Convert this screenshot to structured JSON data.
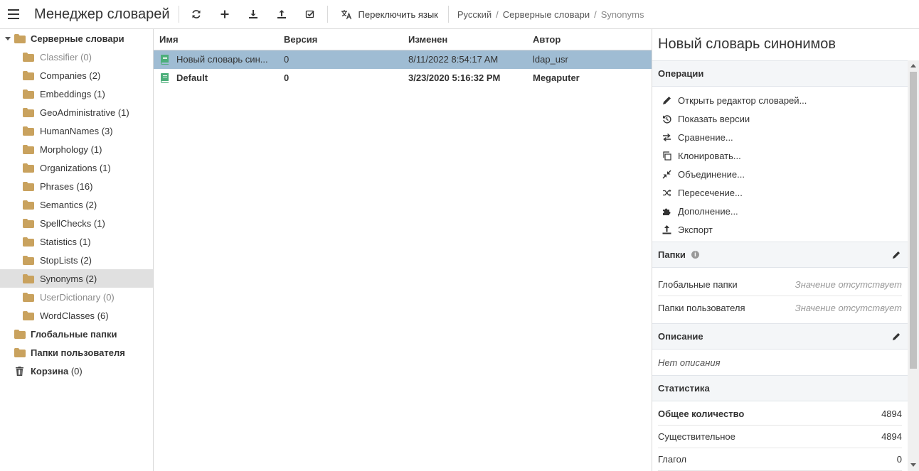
{
  "app": {
    "title": "Менеджер словарей"
  },
  "toolbar": {
    "menu_icon": "hamburger-icon",
    "buttons": [
      "refresh-icon",
      "plus-icon",
      "download-icon",
      "upload-icon",
      "checklist-icon"
    ],
    "switch_language": "Переключить язык"
  },
  "breadcrumb": [
    "Русский",
    "Серверные словари",
    "Synonyms"
  ],
  "tree": {
    "root": {
      "label": "Серверные словари"
    },
    "children": [
      {
        "label": "Classifier",
        "count": "(0)"
      },
      {
        "label": "Companies",
        "count": "(2)"
      },
      {
        "label": "Embeddings",
        "count": "(1)"
      },
      {
        "label": "GeoAdministrative",
        "count": "(1)"
      },
      {
        "label": "HumanNames",
        "count": "(3)"
      },
      {
        "label": "Morphology",
        "count": "(1)"
      },
      {
        "label": "Organizations",
        "count": "(1)"
      },
      {
        "label": "Phrases",
        "count": "(16)"
      },
      {
        "label": "Semantics",
        "count": "(2)"
      },
      {
        "label": "SpellChecks",
        "count": "(1)"
      },
      {
        "label": "Statistics",
        "count": "(1)"
      },
      {
        "label": "StopLists",
        "count": "(2)"
      },
      {
        "label": "Synonyms",
        "count": "(2)"
      },
      {
        "label": "UserDictionary",
        "count": "(0)"
      },
      {
        "label": "WordClasses",
        "count": "(6)"
      }
    ],
    "global_folders": "Глобальные папки",
    "user_folders": "Папки пользователя",
    "trash": {
      "label": "Корзина",
      "count": "(0)"
    }
  },
  "grid": {
    "columns": [
      "Имя",
      "Версия",
      "Изменен",
      "Автор"
    ],
    "rows": [
      {
        "name": "Новый словарь син...",
        "version": "0",
        "modified": "8/11/2022 8:54:17 AM",
        "author": "ldap_usr"
      },
      {
        "name": "Default",
        "version": "0",
        "modified": "3/23/2020 5:16:32 PM",
        "author": "Megaputer"
      }
    ]
  },
  "details": {
    "title": "Новый словарь синонимов",
    "operations_header": "Операции",
    "operations": [
      {
        "icon": "pencil-icon",
        "label": "Открыть редактор словарей..."
      },
      {
        "icon": "history-icon",
        "label": "Показать версии"
      },
      {
        "icon": "compare-icon",
        "label": "Сравнение..."
      },
      {
        "icon": "clone-icon",
        "label": "Клонировать..."
      },
      {
        "icon": "merge-icon",
        "label": "Объединение..."
      },
      {
        "icon": "shuffle-icon",
        "label": "Пересечение..."
      },
      {
        "icon": "puzzle-icon",
        "label": "Дополнение..."
      },
      {
        "icon": "export-icon",
        "label": "Экспорт"
      }
    ],
    "folders_header": "Папки",
    "folders": [
      {
        "label": "Глобальные папки",
        "value": "Значение отсутствует"
      },
      {
        "label": "Папки пользователя",
        "value": "Значение отсутствует"
      }
    ],
    "description_header": "Описание",
    "description": "Нет описания",
    "stats_header": "Статистика",
    "stats": [
      {
        "label": "Общее количество",
        "value": "4894"
      },
      {
        "label": "Существительное",
        "value": "4894"
      },
      {
        "label": "Глагол",
        "value": "0"
      }
    ]
  },
  "colors": {
    "folder": "#c9a25e",
    "book": "#4caf7a",
    "selected_row": "#9fbcd3",
    "selected_tree": "#e0e0e0"
  }
}
